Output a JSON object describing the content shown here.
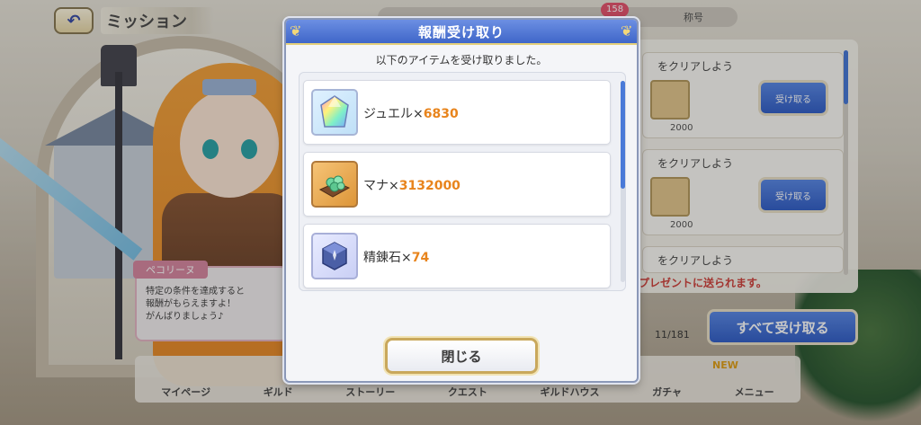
{
  "background": {
    "screen_title": "ミッション",
    "tab_badge": "158",
    "tab_right_label": "称号",
    "speaker_name": "ペコリーヌ",
    "speech_text": "特定の条件を達成すると\n報酬がもらえますよ！\nがんばりましょう♪",
    "missions": [
      {
        "title": "をクリアしよう",
        "qty": "2000",
        "button": "受け取る"
      },
      {
        "title": "をクリアしよう",
        "qty": "2000",
        "button": "受け取る"
      },
      {
        "title": "をクリアしよう"
      }
    ],
    "present_note": "プレゼントに送られます。",
    "receive_all_label": "すべて受け取る",
    "page_count": "11/181",
    "nav": [
      "マイページ",
      "ギルド",
      "ストーリー",
      "クエスト",
      "ギルドハウス",
      "ガチャ",
      "メニュー"
    ],
    "nav_new": "NEW"
  },
  "modal": {
    "title": "報酬受け取り",
    "subtitle": "以下のアイテムを受け取りました。",
    "items": [
      {
        "name": "ジュエル",
        "times": "×",
        "qty": "6830",
        "icon": "jewel-icon"
      },
      {
        "name": "マナ",
        "times": "×",
        "qty": "3132000",
        "icon": "mana-icon"
      },
      {
        "name": "精錬石",
        "times": "×",
        "qty": "74",
        "icon": "refining-stone-icon"
      }
    ],
    "close_label": "閉じる"
  },
  "colors": {
    "accent_blue": "#3f66c9",
    "quantity_orange": "#e8841c",
    "gold_border": "#c9a85c"
  }
}
